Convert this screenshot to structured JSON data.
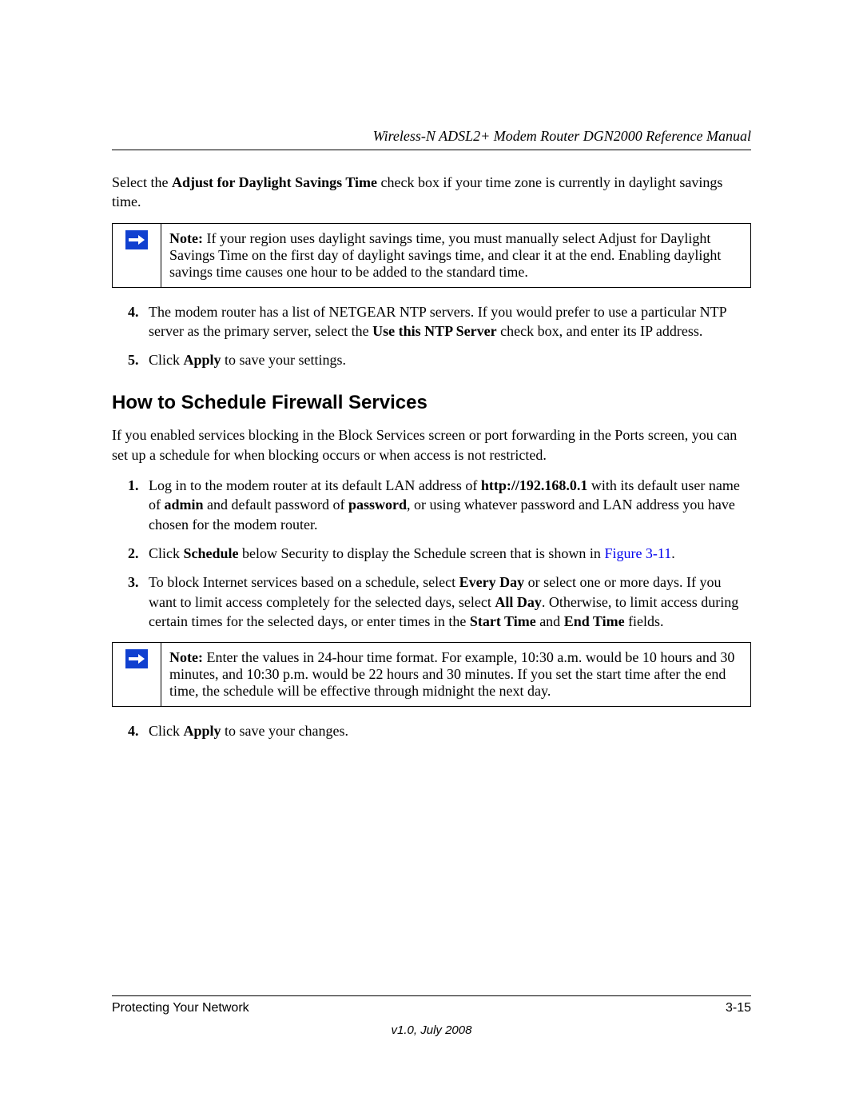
{
  "header": {
    "title": "Wireless-N ADSL2+ Modem Router DGN2000 Reference Manual"
  },
  "intro_para": {
    "pre": "Select the ",
    "bold": "Adjust for Daylight Savings Time",
    "post": " check box if your time zone is currently in daylight savings time."
  },
  "note1": {
    "label": "Note:",
    "text": " If your region uses daylight savings time, you must manually select Adjust for Daylight Savings Time on the first day of daylight savings time, and clear it at the end. Enabling daylight savings time causes one hour to be added to the standard time."
  },
  "steps_a": {
    "4": {
      "num": "4.",
      "t1": "The modem router has a list of NETGEAR NTP servers. If you would prefer to use a particular NTP server as the primary server, select the ",
      "b1": "Use this NTP Server",
      "t2": " check box, and enter its IP address."
    },
    "5": {
      "num": "5.",
      "t1": "Click ",
      "b1": "Apply",
      "t2": " to save your settings."
    }
  },
  "heading": "How to Schedule Firewall Services",
  "sec_para": "If you enabled services blocking in the Block Services screen or port forwarding in the Ports screen, you can set up a schedule for when blocking occurs or when access is not restricted.",
  "steps_b": {
    "1": {
      "num": "1.",
      "t1": "Log in to the modem router at its default LAN address of ",
      "b1": "http://192.168.0.1",
      "t2": " with its default user name of ",
      "b2": "admin",
      "t3": " and default password of ",
      "b3": "password",
      "t4": ", or using whatever password and LAN address you have chosen for the modem router."
    },
    "2": {
      "num": "2.",
      "t1": "Click ",
      "b1": "Schedule",
      "t2": " below Security to display the Schedule screen that is shown in ",
      "link": "Figure 3-11",
      "t3": "."
    },
    "3": {
      "num": "3.",
      "t1": "To block Internet services based on a schedule, select ",
      "b1": "Every Day",
      "t2": " or select one or more days. If you want to limit access completely for the selected days, select ",
      "b2": "All Day",
      "t3": ". Otherwise, to limit access during certain times for the selected days, or enter times in the ",
      "b3": "Start Time",
      "t4": " and ",
      "b4": "End Time",
      "t5": " fields."
    },
    "4": {
      "num": "4.",
      "t1": "Click ",
      "b1": "Apply",
      "t2": " to save your changes."
    }
  },
  "note2": {
    "label": "Note:",
    "text": " Enter the values in 24-hour time format. For example, 10:30 a.m. would be 10 hours and 30 minutes, and 10:30 p.m. would be 22 hours and 30 minutes. If you set the start time after the end time, the schedule will be effective through midnight the next day."
  },
  "footer": {
    "left": "Protecting Your Network",
    "right": "3-15",
    "version": "v1.0, July 2008"
  }
}
